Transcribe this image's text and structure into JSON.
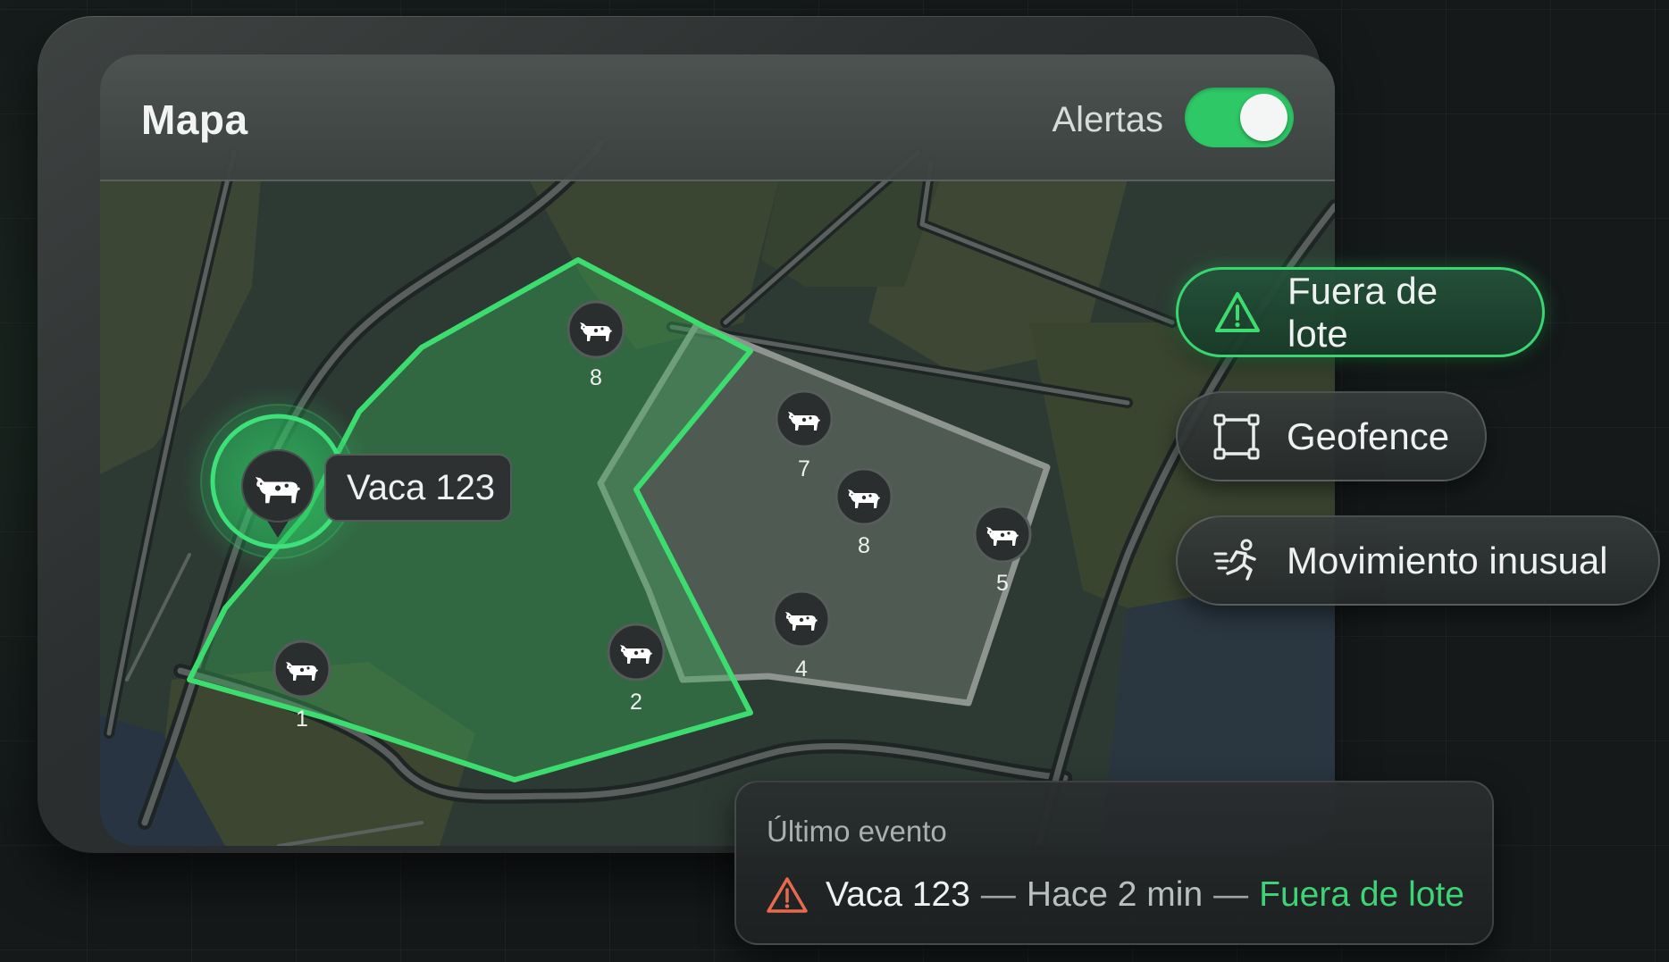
{
  "header": {
    "title": "Mapa",
    "alerts_label": "Alertas",
    "alerts_enabled": true
  },
  "map": {
    "selected_cow": {
      "label": "Vaca 123",
      "icon": "cow-icon"
    },
    "cow_markers": [
      "8",
      "1",
      "2",
      "7",
      "8",
      "5",
      "4"
    ]
  },
  "filters": [
    {
      "label": "Fuera de lote",
      "icon": "warning-triangle-icon",
      "active": true
    },
    {
      "label": "Geofence",
      "icon": "geofence-square-icon",
      "active": false
    },
    {
      "label": "Movimiento inusual",
      "icon": "running-person-icon",
      "active": false
    }
  ],
  "event": {
    "heading": "Último evento",
    "cow": "Vaca 123",
    "sep1": "—",
    "time": "Hace 2 min",
    "sep2": "—",
    "status": "Fuera de lote"
  },
  "colors": {
    "accent_green": "#2ec866",
    "warning_orange": "#e86a4e",
    "geofence_green": "#3ddc6f"
  }
}
